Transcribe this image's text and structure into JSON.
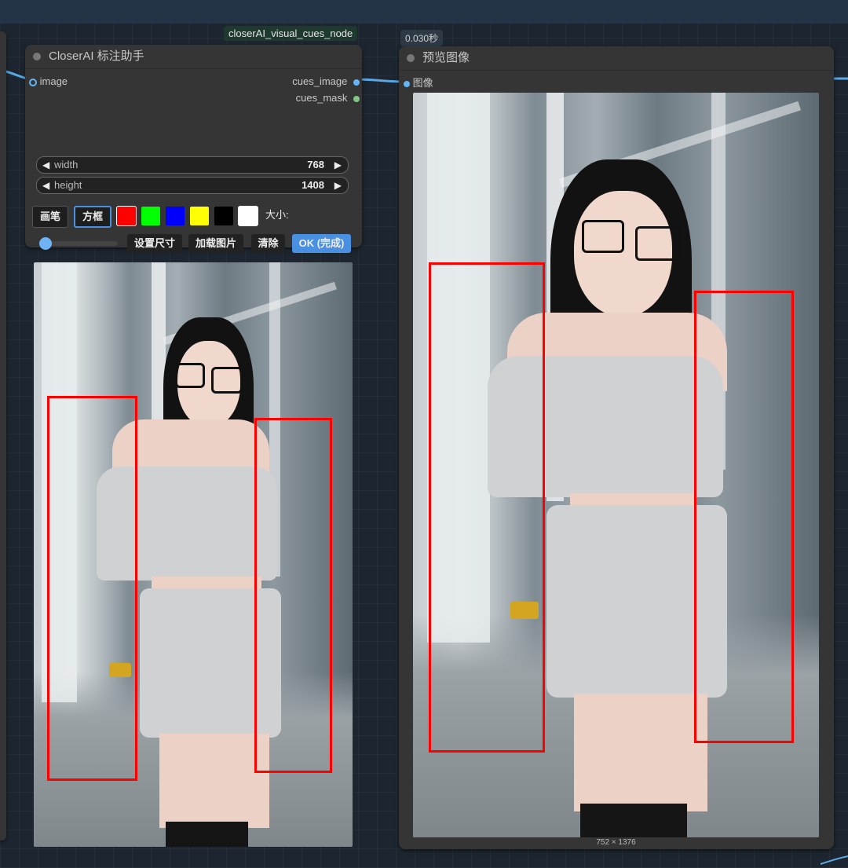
{
  "canvas": {
    "top_node_label": "closerAI_visual_cues_node",
    "timing_label": "0.030秒"
  },
  "annotator_node": {
    "title": "CloserAI 标注助手",
    "inputs": [
      {
        "name": "image",
        "color": "#64b5f6"
      }
    ],
    "outputs": [
      {
        "name": "cues_image",
        "color": "#64b5f6"
      },
      {
        "name": "cues_mask",
        "color": "#81c784"
      }
    ],
    "widgets": [
      {
        "label": "width",
        "value": "768"
      },
      {
        "label": "height",
        "value": "1408"
      }
    ],
    "tools": {
      "brush": "画笔",
      "box": "方框",
      "selected": "box"
    },
    "colors": [
      "#ff0000",
      "#00ff00",
      "#0000ff",
      "#ffff00",
      "#000000",
      "#ffffff"
    ],
    "size_label": "大小:",
    "slider_level": 0.08,
    "actions": {
      "set_size": "设置尺寸",
      "load_image": "加载图片",
      "clear": "清除",
      "ok": "OK (完成)"
    }
  },
  "preview_node": {
    "title": "预览图像",
    "input": {
      "name": "图像",
      "color": "#64b5f6"
    },
    "image_dims": "752 × 1376"
  },
  "colors": {
    "accent_blue": "#4a90e2",
    "mark_red": "#ff0000",
    "node_bg": "#353535",
    "canvas_bg": "#1d2630"
  }
}
